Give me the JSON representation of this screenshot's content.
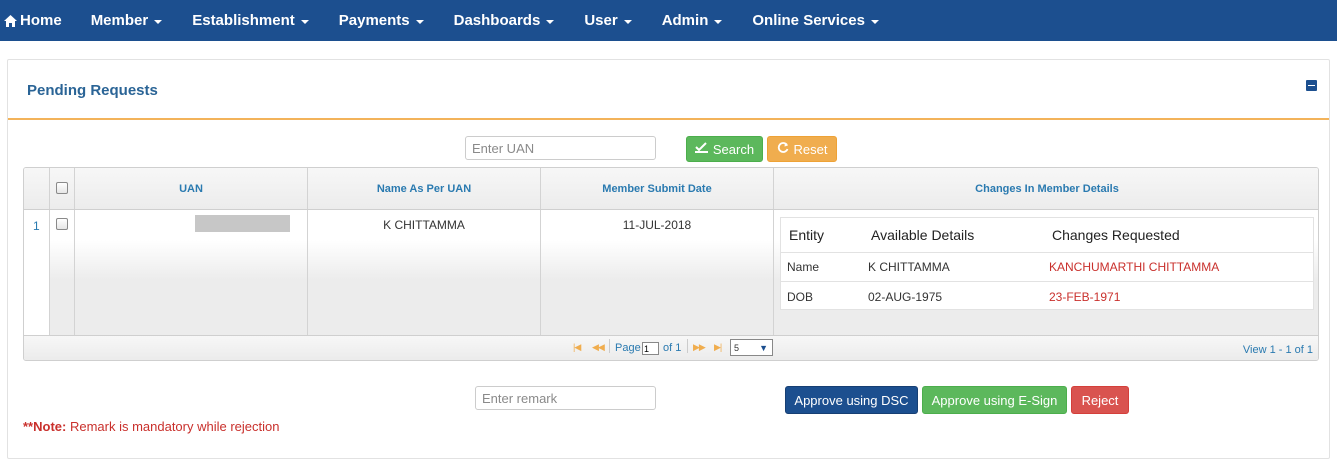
{
  "nav": {
    "items": [
      {
        "label": "Home",
        "icon": "home-icon",
        "dropdown": false
      },
      {
        "label": "Member",
        "dropdown": true
      },
      {
        "label": "Establishment",
        "dropdown": true
      },
      {
        "label": "Payments",
        "dropdown": true
      },
      {
        "label": "Dashboards",
        "dropdown": true
      },
      {
        "label": "User",
        "dropdown": true
      },
      {
        "label": "Admin",
        "dropdown": true
      },
      {
        "label": "Online Services",
        "dropdown": true
      }
    ]
  },
  "panel": {
    "title": "Pending Requests"
  },
  "search": {
    "placeholder": "Enter UAN",
    "search_label": "Search",
    "reset_label": "Reset"
  },
  "grid": {
    "headers": [
      "UAN",
      "Name As Per UAN",
      "Member Submit Date",
      "Changes In Member Details"
    ],
    "rows": [
      {
        "num": "1",
        "uan": "",
        "name": "K CHITTAMMA",
        "submit_date": "11-JUL-2018",
        "changes": {
          "headers": [
            "Entity",
            "Available Details",
            "Changes Requested"
          ],
          "rows": [
            {
              "entity": "Name",
              "available": "K CHITTAMMA",
              "requested": "KANCHUMARTHI CHITTAMMA"
            },
            {
              "entity": "DOB",
              "available": "02-AUG-1975",
              "requested": "23-FEB-1971"
            }
          ]
        }
      }
    ],
    "pager": {
      "page_label": "Page",
      "page_value": "1",
      "of_label": "of 1",
      "page_size": "5",
      "view_info": "View 1 - 1 of 1"
    }
  },
  "actions": {
    "remark_placeholder": "Enter remark",
    "dsc_label": "Approve using DSC",
    "esign_label": "Approve using E-Sign",
    "reject_label": "Reject"
  },
  "note": {
    "prefix": "**Note:",
    "text": " Remark is mandatory while rejection"
  },
  "colors": {
    "navbar": "#1c4f8f",
    "accent": "#f3b35a",
    "success": "#5cb85c",
    "warning": "#f0ad4e",
    "danger": "#d9534f"
  }
}
